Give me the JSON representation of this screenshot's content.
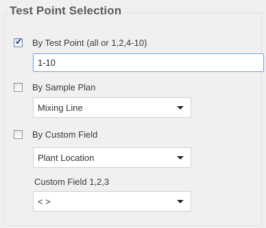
{
  "section": {
    "title": "Test Point Selection"
  },
  "options": {
    "by_test_point": {
      "label": "By Test Point (all or 1,2,4-10)",
      "checked": true,
      "input_value": "1-10"
    },
    "by_sample_plan": {
      "label": "By Sample Plan",
      "checked": false,
      "select_value": "Mixing Line"
    },
    "by_custom_field": {
      "label": "By Custom Field",
      "checked": false,
      "select_value": "Plant Location",
      "sub_label": "Custom Field 1,2,3",
      "sub_select_value": "< >"
    }
  },
  "icons": {
    "checkmark": "✓",
    "dropdown": "chevron-down-icon"
  }
}
